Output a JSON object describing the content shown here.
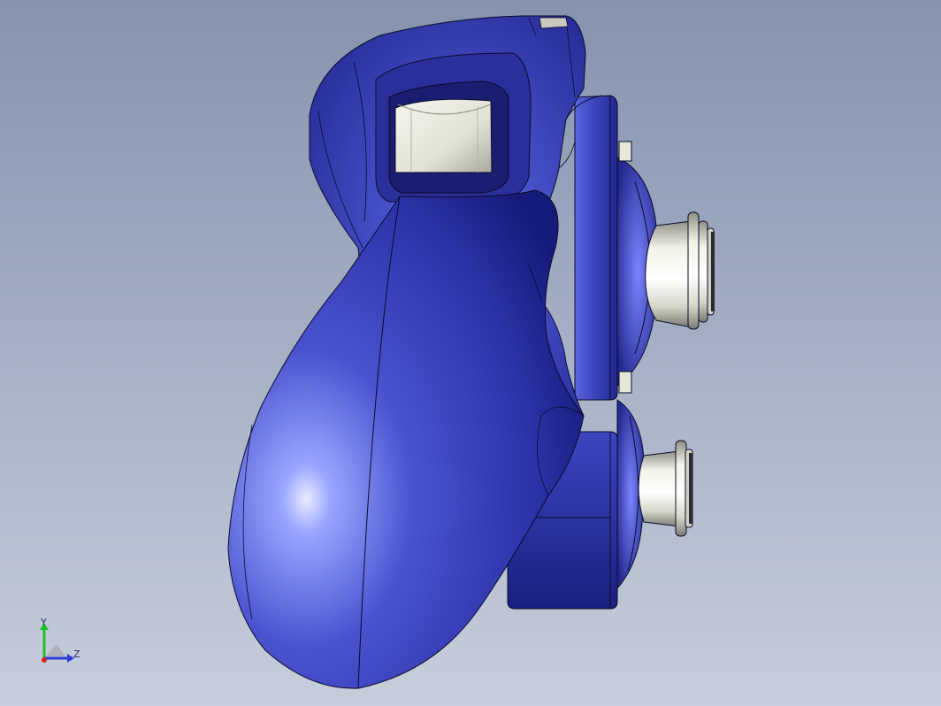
{
  "viewport": {
    "background_top": "#8795b0",
    "background_bottom": "#c4cbd8"
  },
  "model": {
    "name": "game-controller",
    "body_color": "#3c42b8",
    "body_highlight": "#b7c2ff",
    "body_shadow": "#13166a",
    "metal_color": "#e6e6da",
    "edge_color": "#0a0a2a"
  },
  "triad": {
    "y_label": "Y",
    "z_label": "Z",
    "y_color": "#1fbf2a",
    "z_color": "#2b3bd8",
    "x_color": "#d41f1f"
  }
}
